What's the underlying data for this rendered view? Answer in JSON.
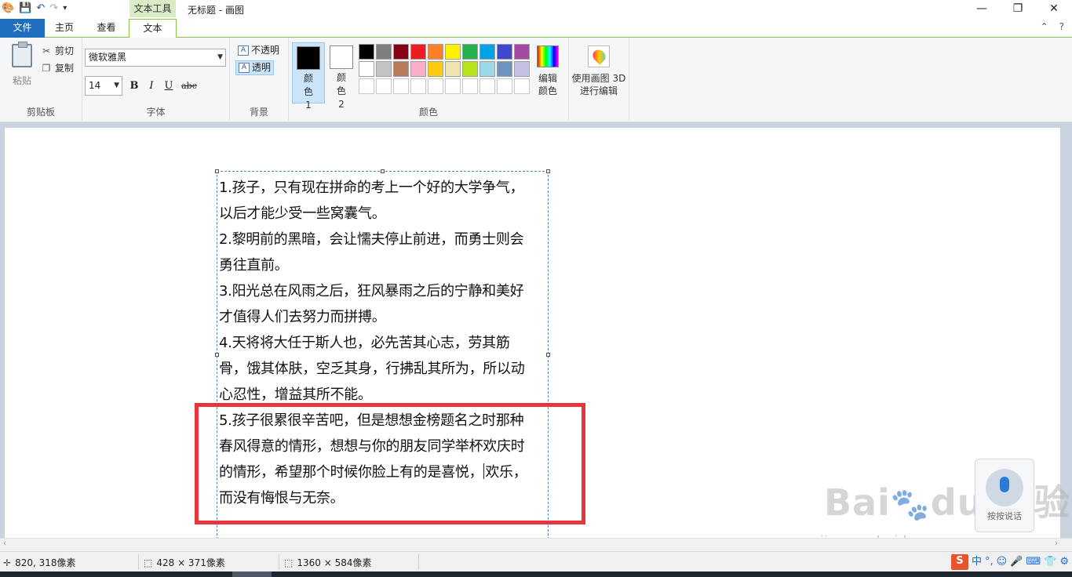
{
  "window": {
    "context_tab_header": "文本工具",
    "title": "无标题 - 画图",
    "minimize": "—",
    "maximize": "❐",
    "close": "✕"
  },
  "tabs": [
    "文件",
    "主页",
    "查看",
    "文本"
  ],
  "clipboard": {
    "paste": "粘贴",
    "cut": "剪切",
    "copy": "复制",
    "group_label": "剪贴板"
  },
  "font": {
    "family": "微软雅黑",
    "size": "14",
    "bold": "B",
    "italic": "I",
    "underline": "U",
    "strike": "abc",
    "group_label": "字体"
  },
  "background": {
    "opaque": "不透明",
    "transparent": "透明",
    "group_label": "背景"
  },
  "colors": {
    "color1_label": "颜色 1",
    "color2_label": "颜色 2",
    "color1": "#000000",
    "color2": "#ffffff",
    "edit_colors": "编辑颜色",
    "paint3d": "使用画图 3D 进行编辑",
    "group_label": "颜色",
    "palette": [
      "#000000",
      "#7f7f7f",
      "#880015",
      "#ed1c24",
      "#ff7f27",
      "#fff200",
      "#22b14c",
      "#00a2e8",
      "#3f48cc",
      "#a349a4",
      "#ffffff",
      "#c3c3c3",
      "#b97a57",
      "#ffaec9",
      "#ffc90e",
      "#efe4b0",
      "#b5e61d",
      "#99d9ea",
      "#7092be",
      "#c8bfe7",
      "#ffffff",
      "#ffffff",
      "#ffffff",
      "#ffffff",
      "#ffffff",
      "#ffffff",
      "#ffffff",
      "#ffffff",
      "#ffffff",
      "#ffffff"
    ]
  },
  "text_lines": [
    "1.孩子，只有现在拼命的考上一个好的大学争气，",
    "以后才能少受一些窝囊气。",
    "2.黎明前的黑暗，会让懦夫停止前进，而勇士则会",
    "勇往直前。",
    "3.阳光总在风雨之后，狂风暴雨之后的宁静和美好",
    "才值得人们去努力而拼搏。",
    "4.天将将大任于斯人也，必先苦其心志，劳其筋",
    "骨，饿其体肤，空乏其身，行拂乱其所为，所以动",
    "心忍性，增益其所不能。",
    "5.孩子很累很辛苦吧，但是想想金榜题名之时那种",
    "春风得意的情形，想想与你的朋友同学举杯欢庆时",
    "的情形，希望那个时候你脸上有的是喜悦，",
    "而没有悔恨与无奈。"
  ],
  "text_line_12_tail": "欢乐，",
  "voice_widget": "按按说话",
  "watermark": {
    "brand": "Bai",
    "brand_du": "du",
    "brand_cn": "经验",
    "url": "jingyan.baidu.com"
  },
  "status": {
    "cursor": "820, 318像素",
    "selection": "428 × 371像素",
    "canvas": "1360 × 584像素"
  },
  "ime": [
    "S",
    "中",
    "°,",
    "☺",
    "🎤",
    "⌨",
    "👕",
    "⚙"
  ]
}
